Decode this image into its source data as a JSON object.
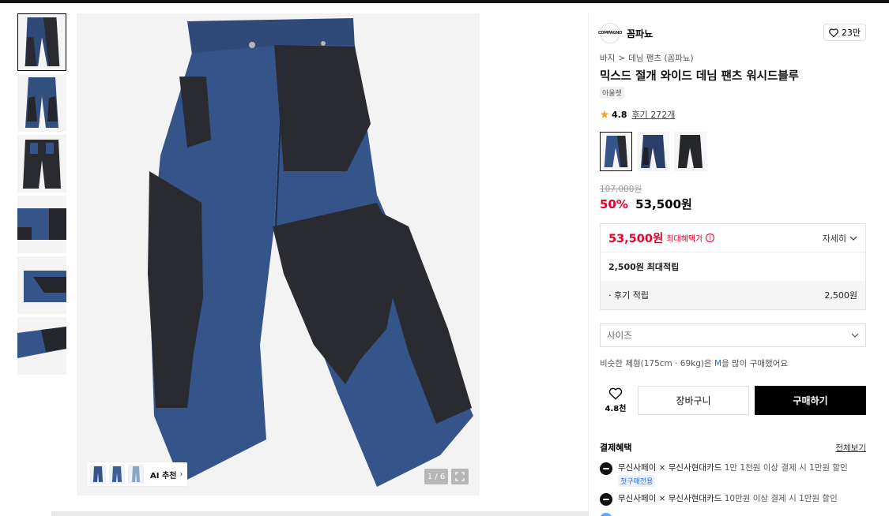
{
  "thumbnails": [
    {
      "name": "thumb-1"
    },
    {
      "name": "thumb-2"
    },
    {
      "name": "thumb-3"
    },
    {
      "name": "thumb-4"
    },
    {
      "name": "thumb-5"
    },
    {
      "name": "thumb-6"
    }
  ],
  "gallery": {
    "ai_label": "AI 추천",
    "counter": "1 / 6"
  },
  "brand": {
    "name": "꼼파뇨",
    "logo_text": "COMPAGNO",
    "likes": "23만"
  },
  "breadcrumb": {
    "level1": "바지",
    "separator": ">",
    "level2": "데님 팬츠 (꼼파뇨)"
  },
  "product": {
    "title": "믹스드 절개 와이드 데님 팬츠 워시드블루",
    "tag": "아울렛",
    "rating": "4.8",
    "reviews": "후기 272개",
    "original_price": "107,000원",
    "discount": "50%",
    "price": "53,500원"
  },
  "benefit": {
    "price": "53,500원",
    "label": "최대혜택가",
    "detail": "자세히",
    "points": "2,500원 최대적립",
    "review_label": "· 후기 적립",
    "review_amount": "2,500원"
  },
  "size": {
    "placeholder": "사이즈",
    "similar_prefix": "비슷한 체형(175cm · 69kg)은 ",
    "similar_size": "M",
    "similar_suffix": "을 많이 구매했어요"
  },
  "actions": {
    "wish_count": "4.8천",
    "cart": "장바구니",
    "buy": "구매하기"
  },
  "payment": {
    "title": "결제혜택",
    "view_all": "전체보기",
    "items": [
      {
        "main": "무신사페이 × 무신사현대카드",
        "detail": "1만 1천원 이상 결제 시 1만원 할인",
        "badge": "첫구매전용"
      },
      {
        "main": "무신사페이 × 무신사현대카드",
        "detail": "10만원 이상 결제 시 1만원 할인"
      }
    ]
  },
  "colors": {
    "accent": "#e5002a",
    "denim_blue": "#2f4a78",
    "denim_black": "#2a2b30"
  }
}
